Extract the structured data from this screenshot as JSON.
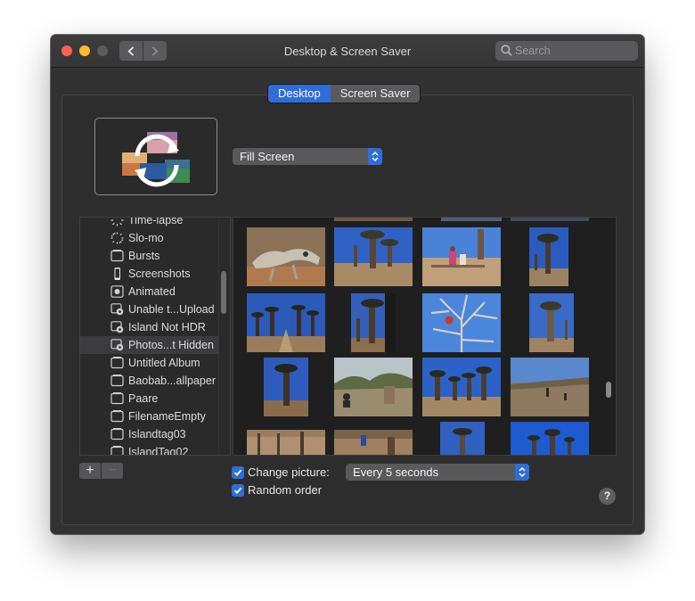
{
  "window": {
    "title": "Desktop & Screen Saver"
  },
  "toolbar": {
    "back_icon": "chevron-left-icon",
    "forward_icon": "chevron-right-icon",
    "grid_icon": "grid-icon"
  },
  "search": {
    "placeholder": "Search",
    "value": ""
  },
  "tabs": [
    {
      "label": "Desktop",
      "active": true
    },
    {
      "label": "Screen Saver",
      "active": false
    }
  ],
  "fill_mode": {
    "selected": "Fill Screen"
  },
  "sidebar": {
    "items": [
      {
        "label": "Time-lapse",
        "icon": "time-lapse-icon"
      },
      {
        "label": "Slo-mo",
        "icon": "slo-mo-icon"
      },
      {
        "label": "Bursts",
        "icon": "bursts-icon"
      },
      {
        "label": "Screenshots",
        "icon": "phone-icon"
      },
      {
        "label": "Animated",
        "icon": "animated-icon"
      },
      {
        "label": "Unable t...Upload",
        "icon": "smart-album-icon"
      },
      {
        "label": "Island Not HDR",
        "icon": "smart-album-icon"
      },
      {
        "label": "Photos...t Hidden",
        "icon": "smart-album-icon",
        "selected": true
      },
      {
        "label": "Untitled Album",
        "icon": "album-icon"
      },
      {
        "label": "Baobab...allpaper",
        "icon": "album-icon"
      },
      {
        "label": "Paare",
        "icon": "album-icon"
      },
      {
        "label": "FilenameEmpty",
        "icon": "album-icon"
      },
      {
        "label": "Islandtag03",
        "icon": "album-icon"
      },
      {
        "label": "IslandTag02",
        "icon": "album-icon"
      }
    ]
  },
  "buttons": {
    "add": "+",
    "remove": "−",
    "help": "?"
  },
  "options": {
    "change_picture_label": "Change picture:",
    "change_picture_checked": true,
    "interval": "Every 5 seconds",
    "random_order_label": "Random order",
    "random_order_checked": true
  },
  "colors": {
    "accent": "#2f6dd8",
    "window_bg": "#323233",
    "close": "#fc5f57",
    "minimize": "#fdbc2e"
  }
}
